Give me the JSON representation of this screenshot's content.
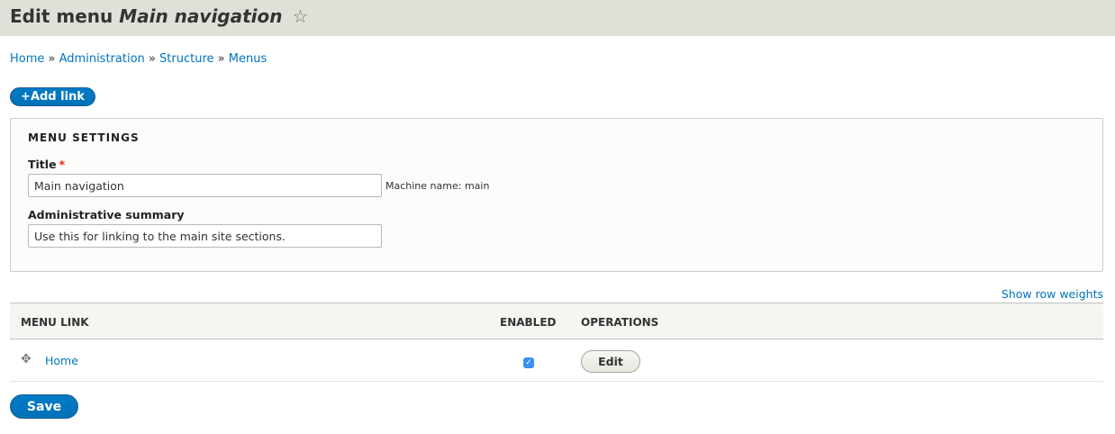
{
  "header": {
    "title_prefix": "Edit menu",
    "title_name": "Main navigation",
    "star_icon": "☆"
  },
  "breadcrumb": [
    {
      "label": "Home"
    },
    {
      "label": "Administration"
    },
    {
      "label": "Structure"
    },
    {
      "label": "Menus"
    }
  ],
  "breadcrumb_separator": "»",
  "add_link_label": "+Add link",
  "menu_settings": {
    "legend": "MENU SETTINGS",
    "title_label": "Title",
    "required_marker": "*",
    "title_value": "Main navigation",
    "machine_name": "Machine name: main",
    "summary_label": "Administrative summary",
    "summary_value": "Use this for linking to the main site sections."
  },
  "show_row_weights": "Show row weights",
  "table": {
    "headers": [
      "MENU LINK",
      "ENABLED",
      "OPERATIONS"
    ],
    "rows": [
      {
        "link": "Home",
        "enabled": true,
        "operation": "Edit"
      }
    ]
  },
  "save_label": "Save",
  "colors": {
    "link": "#0074bd",
    "primary": "#0071b8",
    "header_bg": "#e0e0d8"
  }
}
